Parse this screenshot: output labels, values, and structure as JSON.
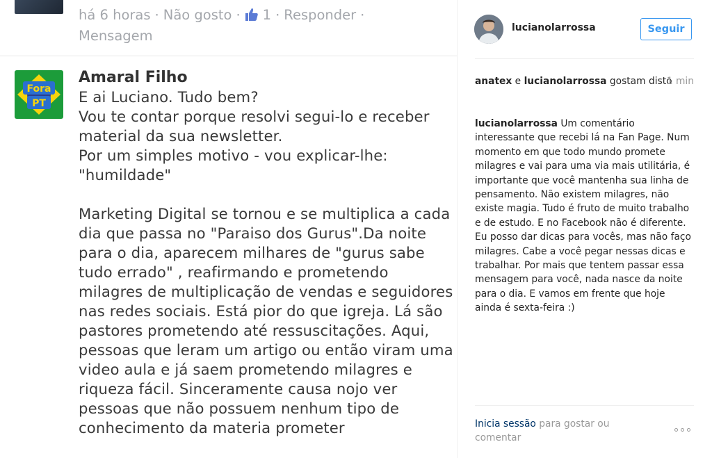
{
  "fb": {
    "prev_meta": {
      "time": "há 6 horas",
      "dislike": "Não gosto",
      "like_count": "1",
      "reply": "Responder",
      "message": "Mensagem"
    },
    "comment": {
      "author": "Amaral Filho",
      "avatar_text": [
        "Fora",
        "PT"
      ],
      "body": "E ai Luciano. Tudo bem?\nVou te contar porque resolvi segui-lo e receber material da sua newsletter.\nPor um simples motivo - vou explicar-lhe: \"humildade\"\n\nMarketing Digital se tornou e se multiplica a cada dia que passa no \"Paraiso dos Gurus\".Da noite para o dia, aparecem milhares de \"gurus sabe tudo errado\" , reafirmando e prometendo milagres de multiplicação de vendas e seguidores nas redes sociais. Está pior do que igreja. Lá são pastores prometendo até ressuscitações. Aqui, pessoas que leram um artigo ou então viram uma video aula e já saem prometendo milagres e riqueza fácil. Sinceramente causa nojo ver pessoas que não possuem nenhum tipo de conhecimento da materia prometer"
    }
  },
  "ig": {
    "username": "lucianolarrossa",
    "follow_label": "Seguir",
    "likes": {
      "user1": "anatex",
      "conj": " e ",
      "user2": "lucianolarrossa",
      "suffix": " gostam disto"
    },
    "time": "1 min",
    "caption": {
      "user": "lucianolarrossa",
      "text": " Um comentário interessante que recebi lá na Fan Page. Num momento em que todo mundo promete milagres e vai para uma via mais utilitária, é importante que você mantenha sua linha de pensamento. Não existem milagres, não existe magia. Tudo é fruto de muito trabalho e de estudo. E no Facebook não é diferente. Eu posso dar dicas para vocês, mas não faço milagres. Cabe a você pegar nessas dicas e trabalhar. Por mais que tentem passar essa mensagem para você, nada nasce da noite para o dia. E vamos em frente que hoje ainda é sexta-feira :)"
    },
    "login": {
      "link": "Inicia sessão",
      "rest": " para gostar ou comentar"
    }
  },
  "colors": {
    "accent": "#3897f0",
    "link_dark": "#003569",
    "muted": "#999999",
    "fb_meta": "#a4a7ac"
  },
  "icons": [
    "thumbs-up-icon",
    "more-options-icon"
  ]
}
